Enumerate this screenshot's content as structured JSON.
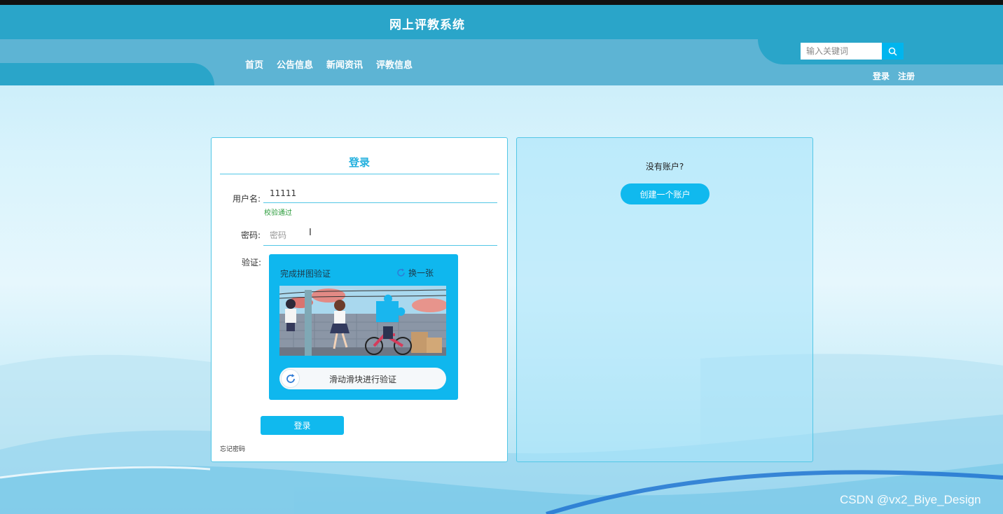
{
  "header": {
    "site_title": "网上评教系统",
    "nav": [
      "首页",
      "公告信息",
      "新闻资讯",
      "评教信息"
    ],
    "search_placeholder": "输入关键词",
    "auth": {
      "login": "登录",
      "register": "注册"
    }
  },
  "login": {
    "title": "登录",
    "username_label": "用户名:",
    "username_value": "11111",
    "username_valid": "校验通过",
    "password_label": "密码:",
    "password_placeholder": "密码",
    "captcha_label": "验证:",
    "captcha": {
      "tip": "完成拼图验证",
      "refresh_label": "换一张",
      "slider_text": "滑动滑块进行验证"
    },
    "submit_label": "登录",
    "forgot_label": "忘记密码"
  },
  "register": {
    "prompt": "没有账户?",
    "create_label": "创建一个账户"
  },
  "watermark": "CSDN @vx2_Biye_Design",
  "colors": {
    "header": "#2aa5c9",
    "nav": "#5db4d4",
    "accent": "#10b9ee",
    "valid": "#2e9d3e"
  }
}
